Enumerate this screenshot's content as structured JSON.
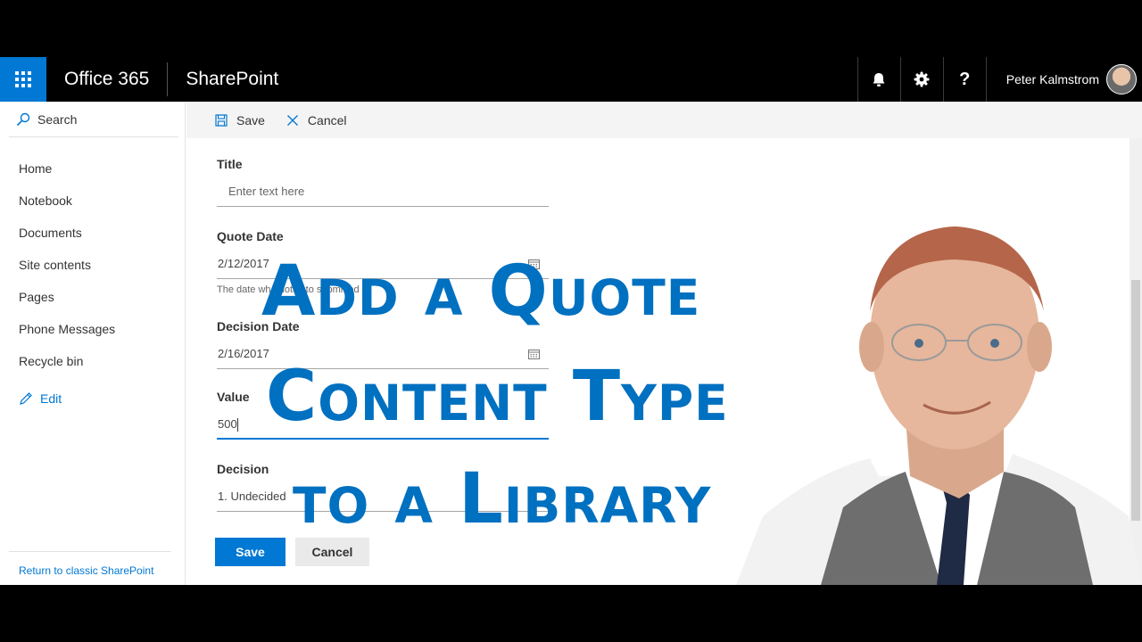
{
  "suitebar": {
    "brand": "Office 365",
    "app": "SharePoint",
    "user_name": "Peter Kalmstrom",
    "help_label": "?"
  },
  "leftnav": {
    "search_label": "Search",
    "items": [
      {
        "label": "Home"
      },
      {
        "label": "Notebook"
      },
      {
        "label": "Documents"
      },
      {
        "label": "Site contents"
      },
      {
        "label": "Pages"
      },
      {
        "label": "Phone Messages"
      },
      {
        "label": "Recycle bin"
      }
    ],
    "edit_label": "Edit",
    "return_label": "Return to classic SharePoint"
  },
  "cmdbar": {
    "save_label": "Save",
    "cancel_label": "Cancel"
  },
  "form": {
    "title": {
      "label": "Title",
      "placeholder": "Enter text here"
    },
    "quote_date": {
      "label": "Quote Date",
      "value": "2/12/2017",
      "hint": "The date wh     quote i   to  submitted"
    },
    "decision_date": {
      "label": "Decision Date",
      "value": "2/16/2017"
    },
    "value": {
      "label": "Value",
      "value": "500"
    },
    "decision": {
      "label": "Decision",
      "value": "1. Undecided"
    },
    "save_label": "Save",
    "cancel_label": "Cancel"
  },
  "overlay": {
    "line1": "Add a Quote",
    "line2": "Content Type",
    "line3": "to a Library"
  },
  "colors": {
    "accent": "#0078d4",
    "overlay_text": "#0070c0",
    "suitebar": "#000000"
  }
}
